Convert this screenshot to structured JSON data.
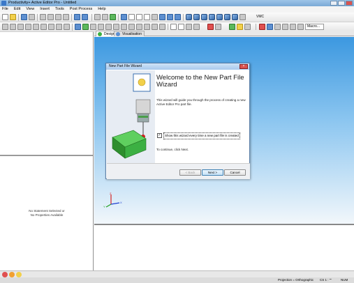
{
  "window": {
    "title": "Productivity+ Active Editor Pro - Untitled"
  },
  "menu": [
    "File",
    "Edit",
    "View",
    "Insert",
    "Tools",
    "Post Process",
    "Help"
  ],
  "toolbar": {
    "view_label": "VMC",
    "macro_label": "Macro..."
  },
  "tabs": [
    {
      "label": "Design"
    },
    {
      "label": "Visualisation"
    }
  ],
  "left_pane": {
    "message_line1": "No Statement Selected or",
    "message_line2": "No Properties Available"
  },
  "dialog": {
    "title": "New Part File Wizard",
    "heading": "Welcome to the New Part File Wizard",
    "body": "This wizard will guide you through the process of creating a new Active Editor Pro part file.",
    "checkbox_label": "Show this wizard every time a new part file is created",
    "checkbox_checked": true,
    "continue_text": "To continue, click Next.",
    "back_label": "< Back",
    "next_label": "Next >",
    "cancel_label": "Cancel"
  },
  "axis": {
    "x": "X",
    "y": "Y",
    "z": "Z"
  },
  "status": {
    "projection": "Projection = Orthographic",
    "cs": "CS 1 : \"\"",
    "num": "NUM"
  },
  "colors": {
    "viewport_top": "#3c98e0",
    "viewport_bottom": "#f2f7fb",
    "block_green": "#3cb043",
    "probe_red": "#d42020"
  }
}
